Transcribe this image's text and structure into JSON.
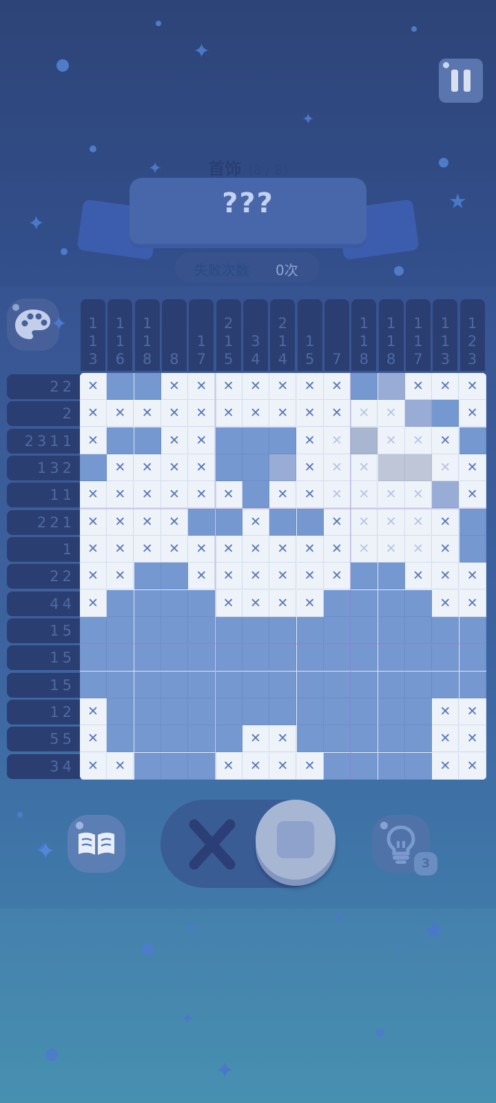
{
  "header": {
    "category": "首饰",
    "progress": "(8 / 8)",
    "puzzle_name": "???",
    "fail_label": "失败次数",
    "fail_value": "0次"
  },
  "icons": {
    "pause": "pause-icon",
    "palette": "palette-icon",
    "guide": "book-icon",
    "hint": "lightbulb-icon",
    "mode_cross": "cross-icon",
    "mode_fill": "square-icon"
  },
  "hint_count": "3",
  "colors": {
    "filled": "#7598d1",
    "empty": "#eef3f9",
    "mark": "#5676b8",
    "clue_bg": "#2b3e72"
  },
  "column_clues": [
    [
      "1",
      "1",
      "3"
    ],
    [
      "1",
      "1",
      "6"
    ],
    [
      "1",
      "1",
      "8"
    ],
    [
      "8"
    ],
    [
      "1",
      "7"
    ],
    [
      "2",
      "1",
      "5"
    ],
    [
      "3",
      "4"
    ],
    [
      "2",
      "1",
      "4"
    ],
    [
      "1",
      "5"
    ],
    [
      "7"
    ],
    [
      "1",
      "1",
      "8"
    ],
    [
      "1",
      "1",
      "8"
    ],
    [
      "1",
      "1",
      "7"
    ],
    [
      "1",
      "1",
      "3"
    ],
    [
      "1",
      "2",
      "3"
    ]
  ],
  "row_clues": [
    "22",
    "2",
    "2311",
    "132",
    "11",
    "221",
    "1",
    "22",
    "44",
    "15",
    "15",
    "15",
    "12",
    "55",
    "34"
  ],
  "grid": [
    "XFFXXXXXXXFgXXX",
    "XXXXXXXXXXxxhFX",
    "XFFXXFFFXxGxxXF",
    "FXXXXFFHXxxSSxX",
    "XXXXXXFXXxxxxhX",
    "XXXXFFXFFXxxxXF",
    "XXXXXXXXXXxxxXF",
    "XXFFXXXXXXFFXXX",
    "XFFFFXXXXFFFFXX",
    "FFFFFFFFFFFFFFF",
    "FFFFFFFFFFFFFFF",
    "FFFFFFFFFFFFFFF",
    "XFFFFFFFFFFFFXX",
    "XFFFFFXXFFFFFXX",
    "XXFFFXXXXFFFFXX"
  ]
}
